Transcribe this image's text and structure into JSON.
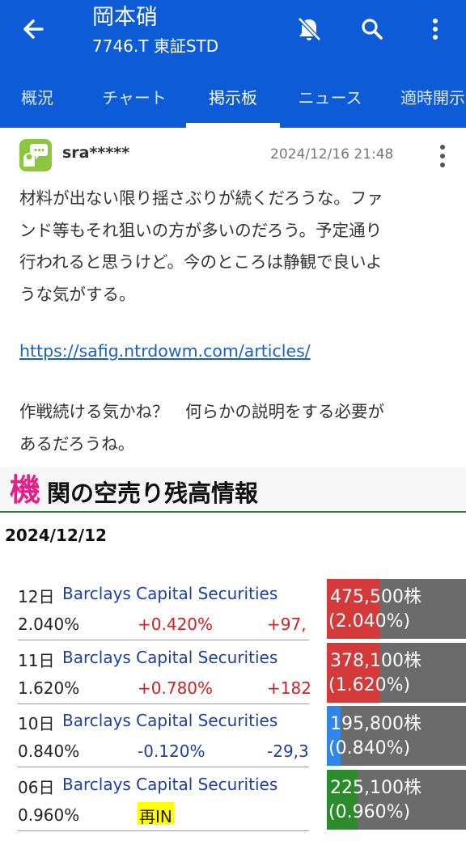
{
  "header": {
    "title": "岡本硝",
    "subtitle": "7746.T 東証STD",
    "icons": [
      "arrow-back-icon",
      "bell-off-icon",
      "search-icon",
      "more-vert-icon"
    ]
  },
  "tabs": [
    {
      "label": "概況",
      "active": false
    },
    {
      "label": "チャート",
      "active": false
    },
    {
      "label": "掲示板",
      "active": true
    },
    {
      "label": "ニュース",
      "active": false
    },
    {
      "label": "適時開示",
      "active": false
    }
  ],
  "post": {
    "username": "sra*****",
    "datetime": "2024/12/16 21:48",
    "body_lines": [
      "材料が出ない限り揺さぶりが続くだろうな。ファ",
      "ンド等もそれ狙いの方が多いのだろう。予定通り",
      "行われると思うけど。今のところは静観で良いよ",
      "うな気がする。"
    ],
    "link": "https://safig.ntrdowm.com/articles/",
    "body2_lines": [
      "作戦続ける気かね？　何らかの説明をする必要が",
      "あるだろうね。"
    ]
  },
  "image": {
    "banner_first": "機",
    "banner_rest": "関の空売り残高情報",
    "date": "2024/12/12",
    "rows": [
      {
        "day": "12日",
        "institution": "Barclays Capital Securities",
        "pct": "2.040%",
        "change": "+0.420%",
        "shares_delta": "+97,",
        "new_label": "",
        "bar_shares": "475,500株",
        "bar_pct": "(2.040%)",
        "bar_color": "#d43a3a",
        "bar_fill": 0.38
      },
      {
        "day": "11日",
        "institution": "Barclays Capital Securities",
        "pct": "1.620%",
        "change": "+0.780%",
        "shares_delta": "+182",
        "new_label": "",
        "bar_shares": "378,100株",
        "bar_pct": "(1.620%)",
        "bar_color": "#d43a3a",
        "bar_fill": 0.38
      },
      {
        "day": "10日",
        "institution": "Barclays Capital Securities",
        "pct": "0.840%",
        "change": "-0.120%",
        "shares_delta": "-29,3",
        "new_label": "",
        "bar_shares": "195,800株",
        "bar_pct": "(0.840%)",
        "bar_color": "#2f86e8",
        "bar_fill": 0.1
      },
      {
        "day": "06日",
        "institution": "Barclays Capital Securities",
        "pct": "0.960%",
        "change": "",
        "shares_delta": "",
        "new_label": "再IN",
        "bar_shares": "225,100株",
        "bar_pct": "(0.960%)",
        "bar_color": "#2c8c2c",
        "bar_fill": 0.22
      }
    ]
  }
}
